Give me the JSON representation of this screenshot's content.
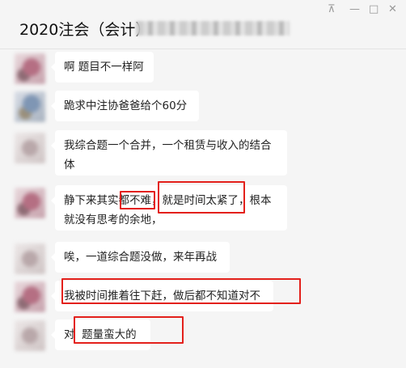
{
  "header": {
    "title": "2020注会（会计）"
  },
  "window_controls": {
    "pin_icon": "pin-icon",
    "minimize_icon": "minimize-icon",
    "maximize_icon": "maximize-icon",
    "close_icon": "close-icon"
  },
  "messages": [
    {
      "text": "啊 题目不一样阿"
    },
    {
      "text": "跪求中注协爸爸给个60分"
    },
    {
      "text": "我综合题一个合并，一个租赁与收入的结合\n体"
    },
    {
      "text": "静下来其实都不难，就是时间太紧了，根本\n就没有思考的余地，"
    },
    {
      "text": "唉，一道综合题没做，来年再战"
    },
    {
      "text": "我被时间推着往下赶，做后都不知道对不"
    },
    {
      "text": "对  题量蛮大的"
    }
  ],
  "colors": {
    "background": "#f5f5f5",
    "bubble": "#ffffff",
    "highlight": "#e3201b"
  }
}
